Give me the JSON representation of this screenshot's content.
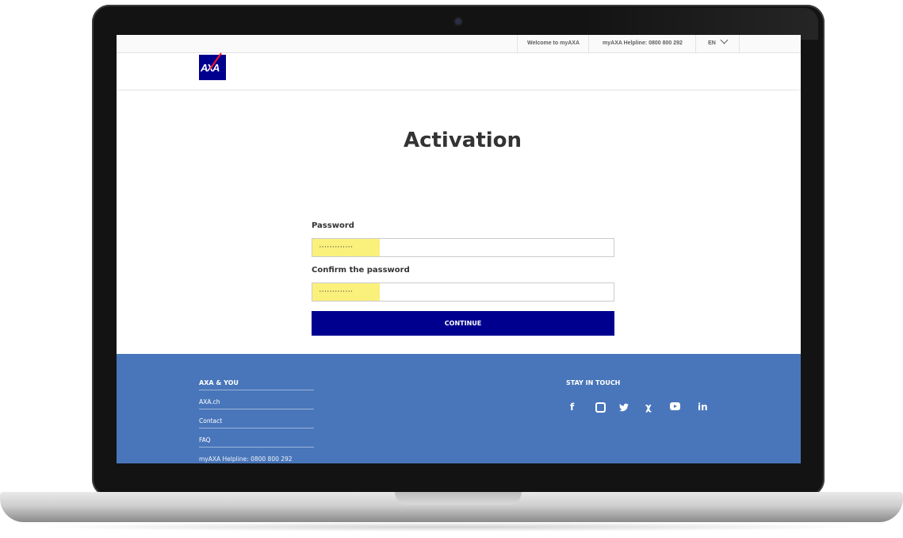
{
  "topbar": {
    "welcome": "Welcome to myAXA",
    "helpline": "myAXA Helpline: 0800 800 292",
    "language": "EN"
  },
  "brand": {
    "logo_text": "AXA",
    "color_primary": "#00008f",
    "color_accent": "#ff1721",
    "footer_color": "#4976ba"
  },
  "page": {
    "title": "Activation"
  },
  "form": {
    "password_label": "Password",
    "password_value": "·············",
    "confirm_label": "Confirm the password",
    "confirm_value": "·············",
    "continue_label": "CONTINUE"
  },
  "footer": {
    "axa_you_heading": "AXA & YOU",
    "links": [
      "AXA.ch",
      "Contact",
      "FAQ",
      "myAXA Helpline: 0800 800 292"
    ],
    "stay_in_touch_heading": "STAY IN TOUCH",
    "social_icons": [
      "facebook-icon",
      "instagram-icon",
      "twitter-icon",
      "xing-icon",
      "youtube-icon",
      "linkedin-icon"
    ],
    "social_glyphs": {
      "facebook": "f",
      "twitter": "🐦",
      "xing": "χ",
      "linkedin": "in"
    }
  }
}
